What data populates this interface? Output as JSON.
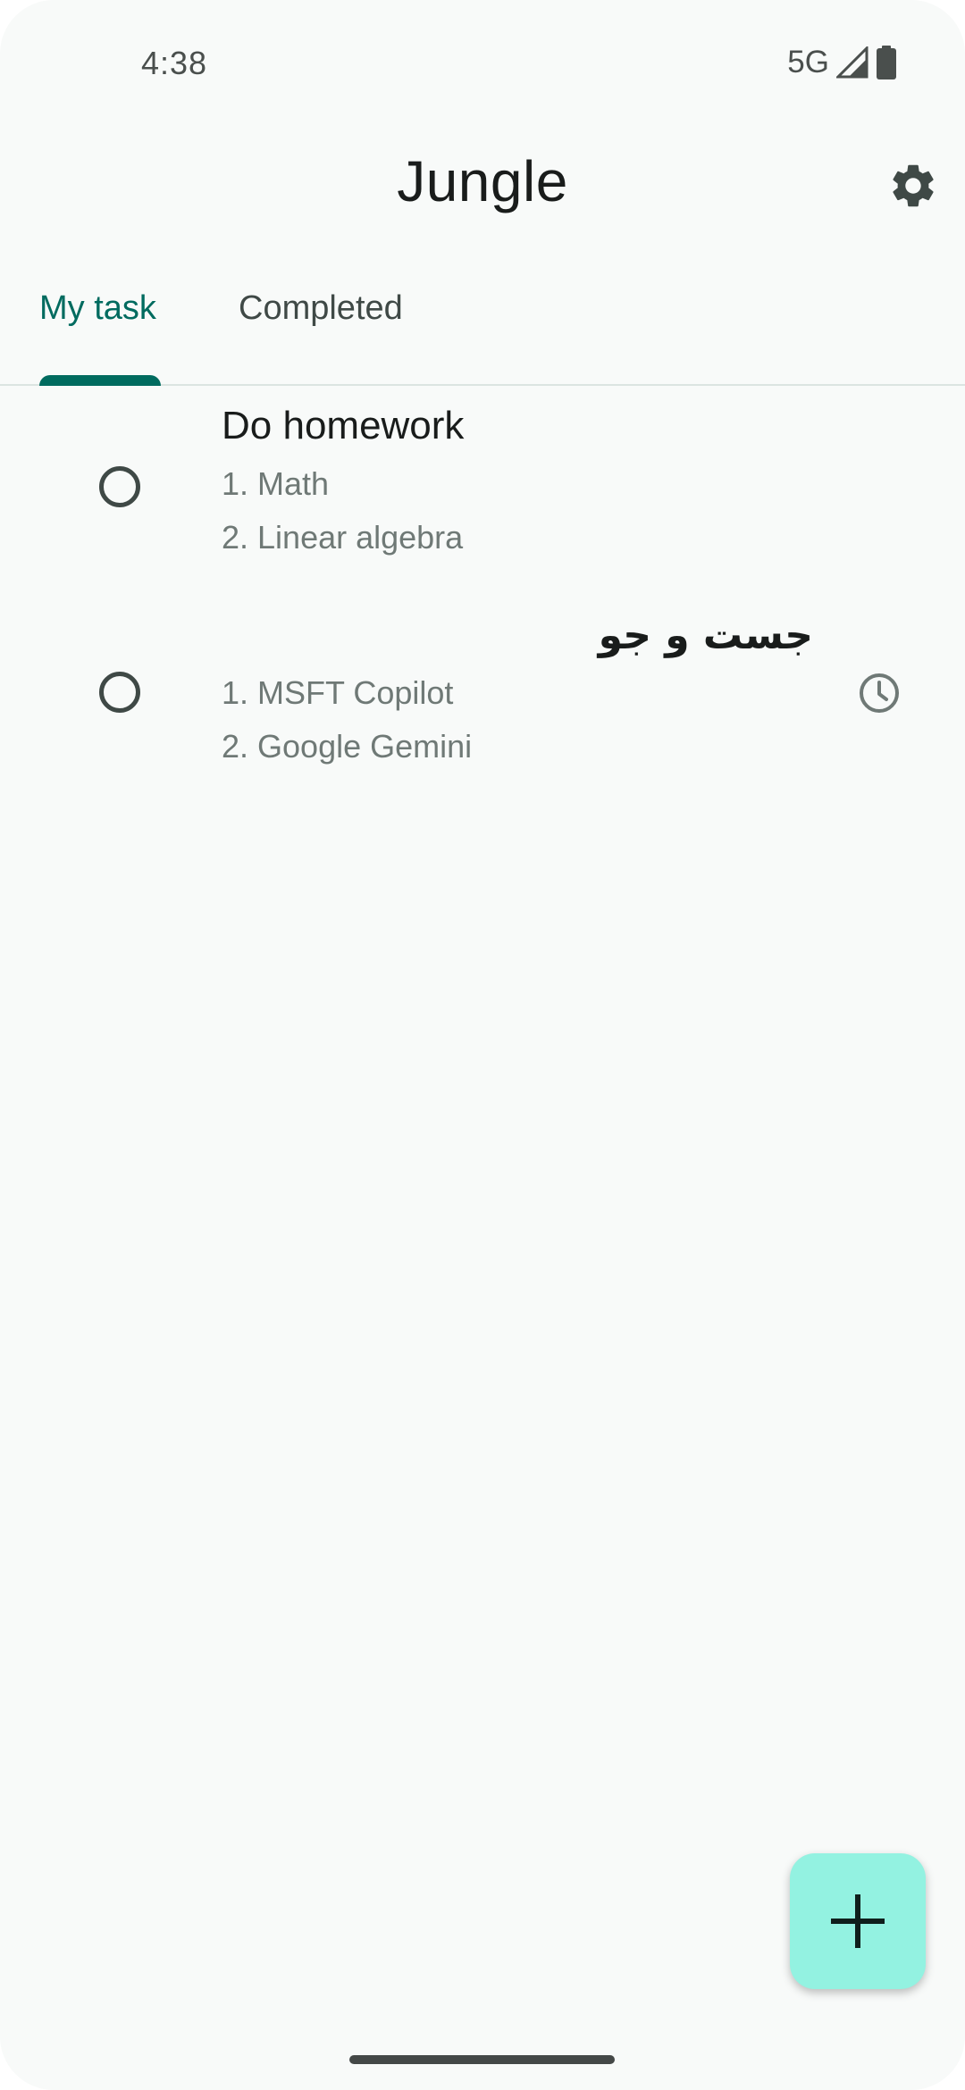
{
  "status_bar": {
    "time": "4:38",
    "network": "5G",
    "signal_icon": "cellular-signal-icon",
    "battery_icon": "battery-full-icon"
  },
  "app_bar": {
    "title": "Jungle",
    "settings_icon": "gear-icon"
  },
  "tabs": [
    {
      "label": "My task",
      "selected": true
    },
    {
      "label": "Completed",
      "selected": false
    }
  ],
  "tasks": [
    {
      "title": "Do homework",
      "lines": [
        "1. Math",
        "2. Linear algebra"
      ],
      "has_reminder": false
    },
    {
      "title": "جست و جو",
      "lines": [
        "1. MSFT Copilot",
        "2. Google Gemini"
      ],
      "has_reminder": true,
      "reminder_icon": "clock-icon"
    }
  ],
  "fab": {
    "icon": "plus-icon"
  },
  "colors": {
    "accent": "#006b5f",
    "fab_bg": "#93f2e1",
    "background": "#f8faf9",
    "text_primary": "#191c1b",
    "text_secondary": "#6f7976"
  }
}
